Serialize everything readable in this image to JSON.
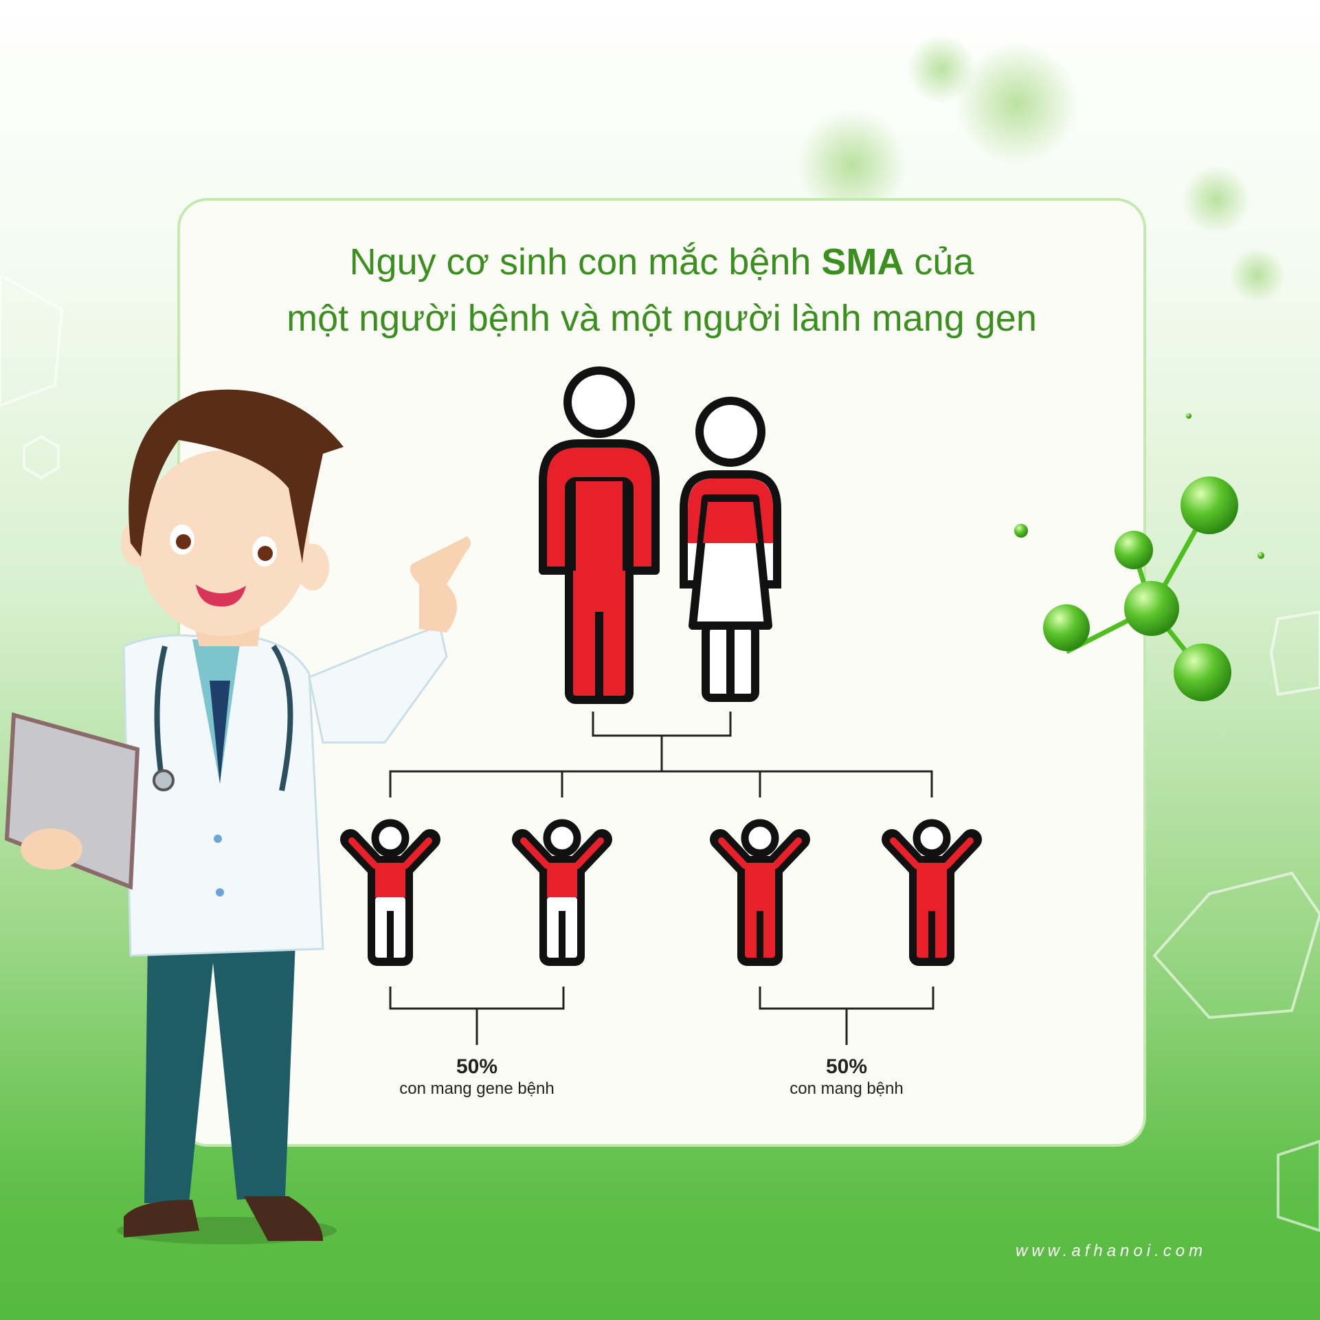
{
  "title": {
    "line1_prefix": "Nguy cơ sinh con mắc bệnh",
    "line1_bold": "SMA",
    "line1_suffix": "của",
    "line2": "một người bệnh và một người lành mang gen"
  },
  "outcomes": [
    {
      "percent": "50%",
      "label": "con mang gene bệnh"
    },
    {
      "percent": "50%",
      "label": "con mang bệnh"
    }
  ],
  "website": "www.afhanoi.com",
  "colors": {
    "title": "#3a8f1f",
    "affected": "#e8202a",
    "outline": "#111111",
    "card": "#fcfcf7"
  }
}
